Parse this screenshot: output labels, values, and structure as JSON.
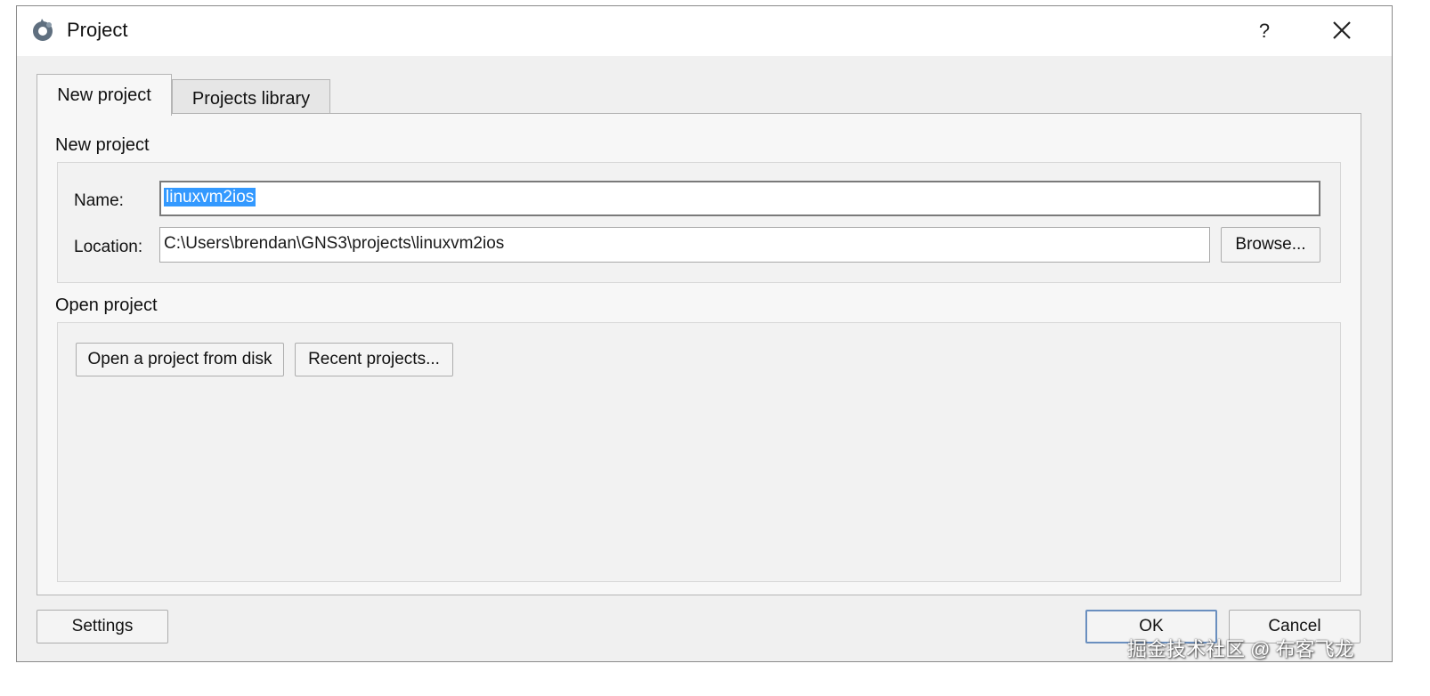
{
  "window": {
    "title": "Project",
    "help_glyph": "?",
    "icon": "gns3-app-icon",
    "close_icon": "close-icon"
  },
  "tabs": [
    {
      "label": "New project",
      "active": true
    },
    {
      "label": "Projects library",
      "active": false
    }
  ],
  "new_project": {
    "section_title": "New project",
    "name_label": "Name:",
    "name_value": "linuxvm2ios",
    "location_label": "Location:",
    "location_value": "C:\\Users\\brendan\\GNS3\\projects\\linuxvm2ios",
    "browse_label": "Browse..."
  },
  "open_project": {
    "section_title": "Open project",
    "open_from_disk_label": "Open a project from disk",
    "recent_projects_label": "Recent projects..."
  },
  "footer": {
    "settings_label": "Settings",
    "ok_label": "OK",
    "cancel_label": "Cancel"
  },
  "colors": {
    "dialog_bg": "#f0f0f0",
    "selection": "#3399ff",
    "default_button_border": "#6a8fbf"
  },
  "watermark": "掘金技术社区 @ 布客飞龙"
}
